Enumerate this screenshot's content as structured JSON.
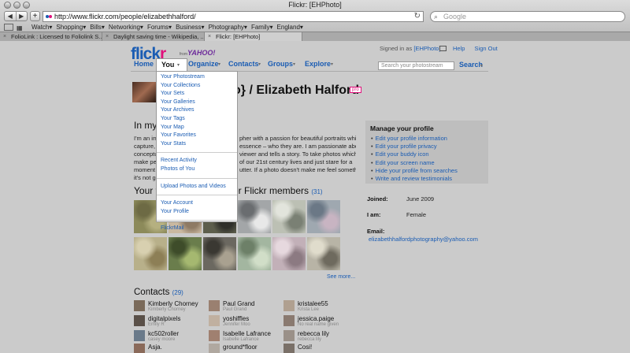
{
  "window": {
    "title": "Flickr: [EHPhoto]"
  },
  "toolbar": {
    "back": "◀",
    "forward": "▶",
    "add_bookmark": "+",
    "url": "http://www.flickr.com/people/elizabethhalford/",
    "reload": "↻",
    "search_placeholder": "Google"
  },
  "bookmarks": {
    "items": [
      "Watch▾",
      "Shopping▾",
      "Bills▾",
      "Networking▾",
      "Forums▾",
      "Business▾",
      "Photography▾",
      "Family▾",
      "England▾"
    ]
  },
  "tabs": [
    {
      "label": "FolioLink : Licensed to Foliolink S...",
      "active": false
    },
    {
      "label": "Daylight saving time - Wikipedia, ...",
      "active": false
    },
    {
      "label": "Flickr: [EHPhoto]",
      "active": true
    }
  ],
  "header": {
    "logo_a": "flick",
    "logo_b": "r",
    "from": "from",
    "yahoo": "YAHOO!",
    "signed_in_prefix": "Signed in as",
    "signed_in_user": "[EHPhoto]",
    "help": "Help",
    "sign_out": "Sign Out"
  },
  "nav": {
    "home": "Home",
    "you": "You",
    "organize": "Organize",
    "contacts": "Contacts",
    "groups": "Groups",
    "explore": "Explore",
    "dd": "▾",
    "search_placeholder": "Search your photostream",
    "search": "Search"
  },
  "dropdown": {
    "group1": [
      "Your Photostream",
      "Your Collections",
      "Your Sets",
      "Your Galleries",
      "Your Archives",
      "Your Tags",
      "Your Map",
      "Your Favorites",
      "Your Stats"
    ],
    "group2": [
      "Recent Activity",
      "Photos of You"
    ],
    "group3": [
      "Upload Photos and Videos"
    ],
    "group4": [
      "Your Account",
      "Your Profile"
    ],
    "group5": [
      "FlickrMail"
    ]
  },
  "profile": {
    "headline": "o} / Elizabeth Halford",
    "pro": "pro",
    "in_my": "In my o",
    "bio_left": [
      "I'm an ima",
      "capture, r",
      "conceptua",
      "make peop",
      "moment in",
      "it's not go"
    ],
    "bio_right": [
      "pher with a passion for beautiful portraits which",
      "essence – who they are. I am passionate about",
      "viewer and tells a story. To take photos which",
      "of our 21st century lives and just stare for a",
      "utter. If a photo doesn't make me feel something,",
      ""
    ],
    "joined_label": "Joined:",
    "joined": "June 2009",
    "iam_label": "I am:",
    "iam": "Female",
    "email_label": "Email:",
    "email": "elizabethhalfordphotography@yahoo.com"
  },
  "manage": {
    "title": "Manage your profile",
    "links": [
      "Edit your profile information",
      "Edit your profile privacy",
      "Edit your buddy icon",
      "Edit your screen name",
      "Hide your profile from searches",
      "Write and review testimonials"
    ]
  },
  "favorites": {
    "heading_left": "Your fa",
    "heading_right": "er Flickr members",
    "count": "(31)",
    "see_more": "See more..."
  },
  "contacts": {
    "heading": "Contacts",
    "count": "(29)",
    "items": [
      {
        "name": "Kimberly Chorney",
        "real": "Kimberly Chorney"
      },
      {
        "name": "Paul Grand",
        "real": "Paul Grand"
      },
      {
        "name": "kristalee55",
        "real": "Krista Lee"
      },
      {
        "name": "digitalpixels",
        "real": "Emily R"
      },
      {
        "name": "yoshiffles",
        "real": "Jennifer Moo"
      },
      {
        "name": "jessica.paige",
        "real": "No real name given"
      },
      {
        "name": "kc502roller",
        "real": "casey moore"
      },
      {
        "name": "Isabelle Lafrance",
        "real": "Isabelle Lafrance"
      },
      {
        "name": "rebecca lily",
        "real": "rebecca lily"
      },
      {
        "name": "Asja.",
        "real": ""
      },
      {
        "name": "ground*floor",
        "real": ""
      },
      {
        "name": "Cosi!",
        "real": ""
      }
    ]
  },
  "colors": {
    "link": "#1a5cb3",
    "flickr_pink": "#e0107b",
    "page_bg": "#cbcbcb"
  }
}
